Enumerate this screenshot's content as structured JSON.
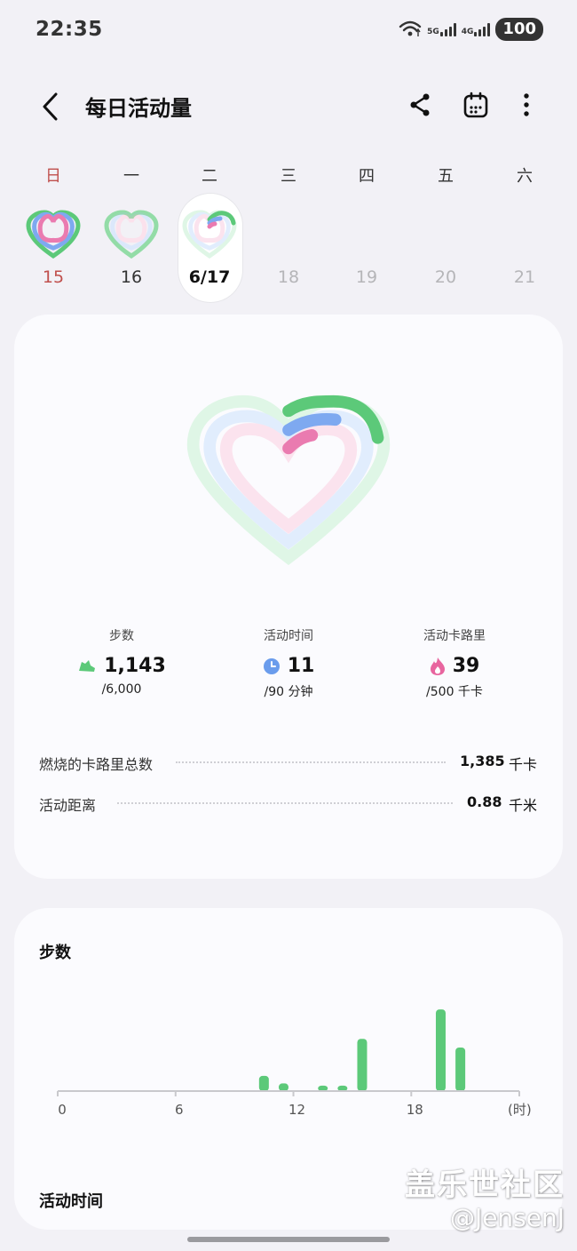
{
  "status_bar": {
    "time": "22:35",
    "net1": "5G",
    "net2": "4G",
    "battery": "100"
  },
  "header": {
    "title": "每日活动量",
    "icons": [
      "back-icon",
      "share-icon",
      "calendar-icon",
      "more-icon"
    ]
  },
  "week": {
    "days": [
      {
        "weekday": "日",
        "date": "15",
        "state": "past"
      },
      {
        "weekday": "一",
        "date": "16",
        "state": "past"
      },
      {
        "weekday": "二",
        "date": "6/17",
        "state": "selected"
      },
      {
        "weekday": "三",
        "date": "18",
        "state": "future"
      },
      {
        "weekday": "四",
        "date": "19",
        "state": "future"
      },
      {
        "weekday": "五",
        "date": "20",
        "state": "future"
      },
      {
        "weekday": "六",
        "date": "21",
        "state": "future"
      }
    ]
  },
  "rings": {
    "steps_progress": 0.19,
    "active_time_progress": 0.12,
    "calories_progress": 0.08,
    "colors": {
      "steps": "#5cc979",
      "active_time": "#7ea9f0",
      "calories": "#ea7bb0"
    }
  },
  "stats": {
    "steps": {
      "label": "步数",
      "value": "1,143",
      "goal": "/6,000"
    },
    "active_time": {
      "label": "活动时间",
      "value": "11",
      "goal": "/90 分钟"
    },
    "calories": {
      "label": "活动卡路里",
      "value": "39",
      "goal": "/500 千卡"
    }
  },
  "details": [
    {
      "label": "燃烧的卡路里总数",
      "value": "1,385",
      "unit": "千卡"
    },
    {
      "label": "活动距离",
      "value": "0.88",
      "unit": "千米"
    }
  ],
  "steps_section": {
    "title": "步数"
  },
  "chart_data": {
    "type": "bar",
    "x": [
      10,
      11,
      13,
      14,
      15,
      19,
      20
    ],
    "values": [
      70,
      35,
      25,
      25,
      240,
      375,
      200
    ],
    "xlim": [
      0,
      23.5
    ],
    "ylim": [
      0,
      400
    ],
    "xticks": [
      "0",
      "6",
      "12",
      "18"
    ],
    "xtick_values": [
      0,
      6,
      12,
      18
    ],
    "xunit": "(时)",
    "color": "#5cc979"
  },
  "active_time_section": {
    "title": "活动时间"
  },
  "watermark": {
    "line1": "盖乐世社区",
    "line2": "@JensenJ"
  }
}
